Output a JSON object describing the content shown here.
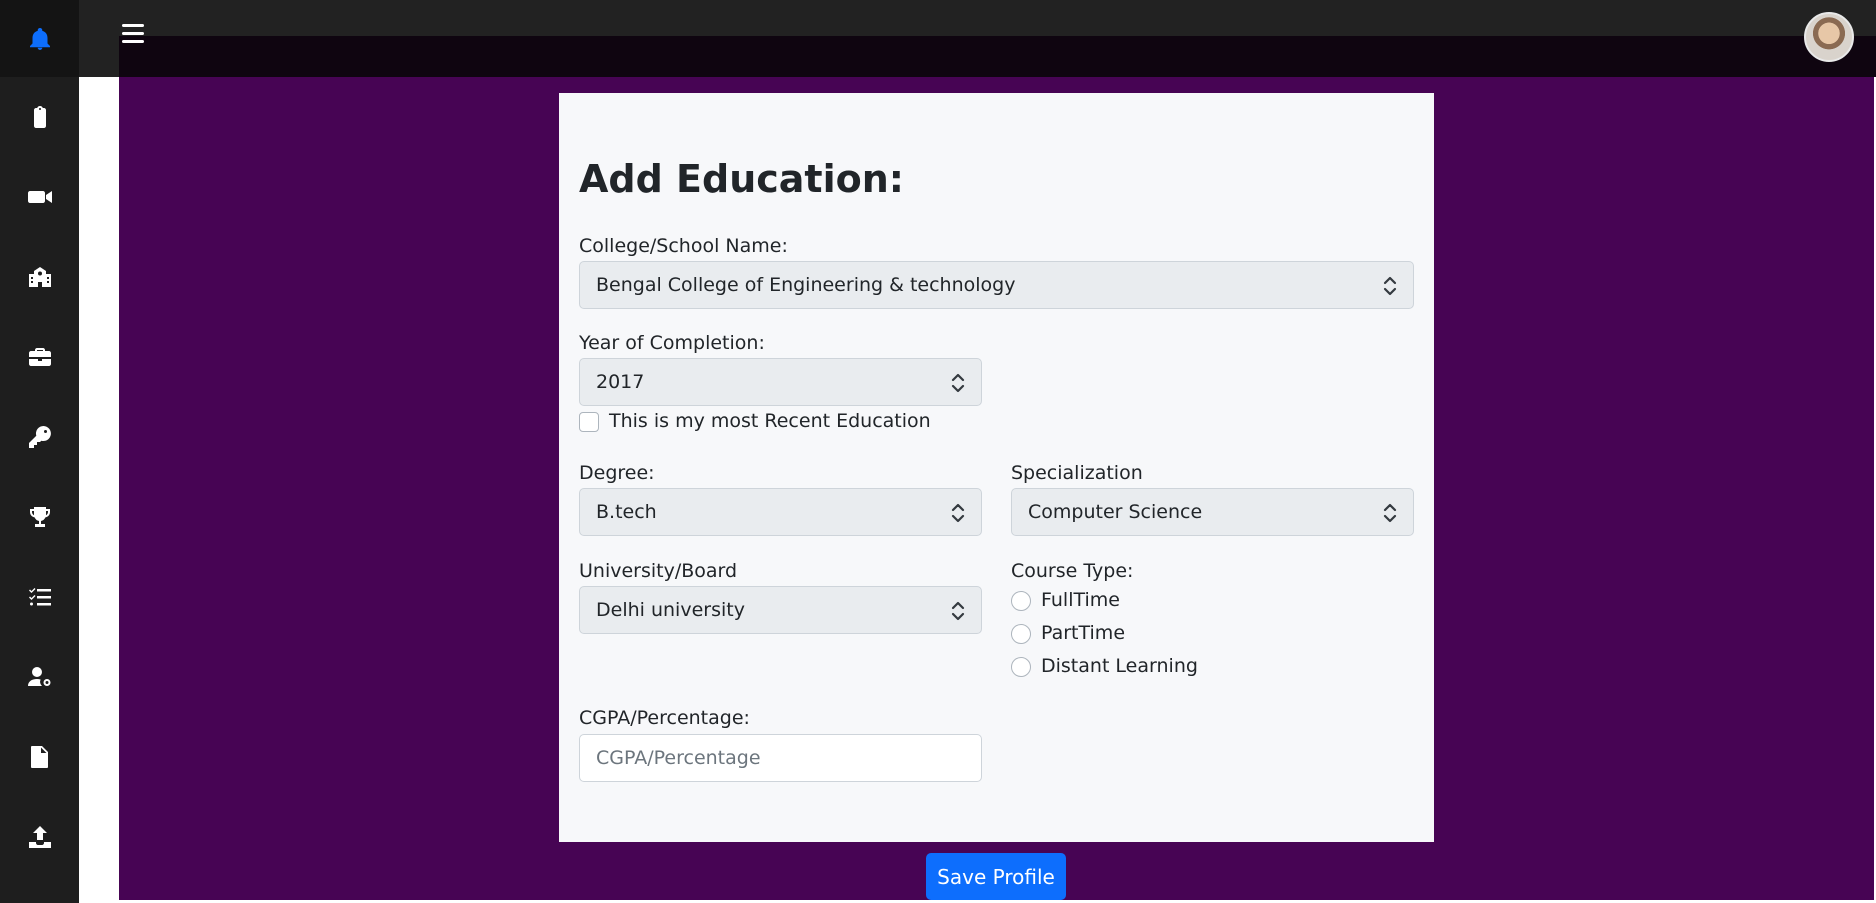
{
  "sidebar": {
    "items": [
      {
        "icon": "clipboard-icon"
      },
      {
        "icon": "video-camera-icon"
      },
      {
        "icon": "school-icon"
      },
      {
        "icon": "briefcase-icon"
      },
      {
        "icon": "key-icon"
      },
      {
        "icon": "trophy-icon"
      },
      {
        "icon": "tasks-list-icon"
      },
      {
        "icon": "user-settings-icon"
      },
      {
        "icon": "document-icon"
      },
      {
        "icon": "upload-icon"
      }
    ],
    "top_icon": "bell-icon",
    "accent_color": "#0d6efd"
  },
  "form": {
    "title": "Add Education:",
    "college": {
      "label": "College/School Name:",
      "value": "Bengal College of Engineering & technology"
    },
    "year": {
      "label": "Year of Completion:",
      "value": "2017"
    },
    "recent": {
      "label": "This is my most Recent Education",
      "checked": false
    },
    "degree": {
      "label": "Degree:",
      "value": "B.tech"
    },
    "specialization": {
      "label": "Specialization",
      "value": "Computer Science"
    },
    "university": {
      "label": "University/Board",
      "value": "Delhi university"
    },
    "course_type": {
      "label": "Course Type:",
      "options": [
        "FullTime",
        "PartTime",
        "Distant Learning"
      ],
      "selected": null
    },
    "cgpa": {
      "label": "CGPA/Percentage:",
      "placeholder": "CGPA/Percentage",
      "value": ""
    },
    "save_label": "Save Profile"
  },
  "colors": {
    "main_bg": "#470454",
    "card_bg": "#f7f8fa",
    "button": "#0d6efd"
  }
}
